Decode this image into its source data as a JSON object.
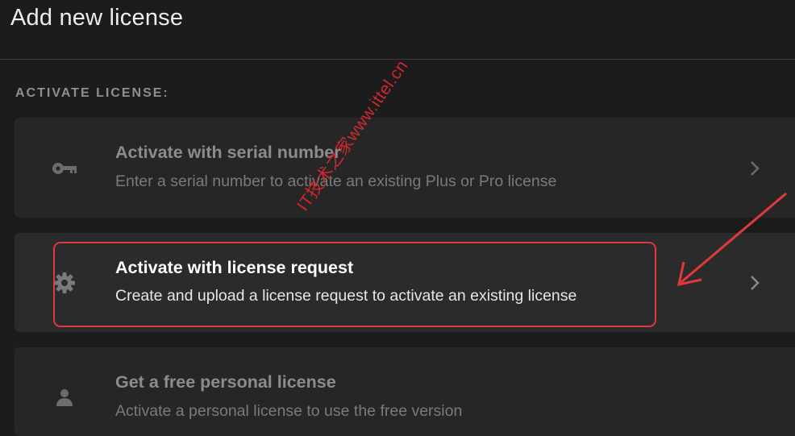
{
  "header": {
    "title": "Add new license"
  },
  "section": {
    "label": "ACTIVATE LICENSE:"
  },
  "options": [
    {
      "title": "Activate with serial number",
      "description": "Enter a serial number to activate an existing Plus or Pro license",
      "icon": "key-icon",
      "state": "dimmed"
    },
    {
      "title": "Activate with license request",
      "description": "Create and upload a license request to activate an existing license",
      "icon": "gear-icon",
      "state": "active"
    },
    {
      "title": "Get a free personal license",
      "description": "Activate a personal license to use the free version",
      "icon": "person-icon",
      "state": "dimmed"
    }
  ],
  "annotation": {
    "highlight_color": "#e2393d"
  },
  "watermark": {
    "text": "IT技术之家www.ittel.cn"
  },
  "colors": {
    "background": "#1c1c1c",
    "card": "#262626",
    "card_active": "#2b2b2b",
    "accent_red": "#e2393d"
  }
}
